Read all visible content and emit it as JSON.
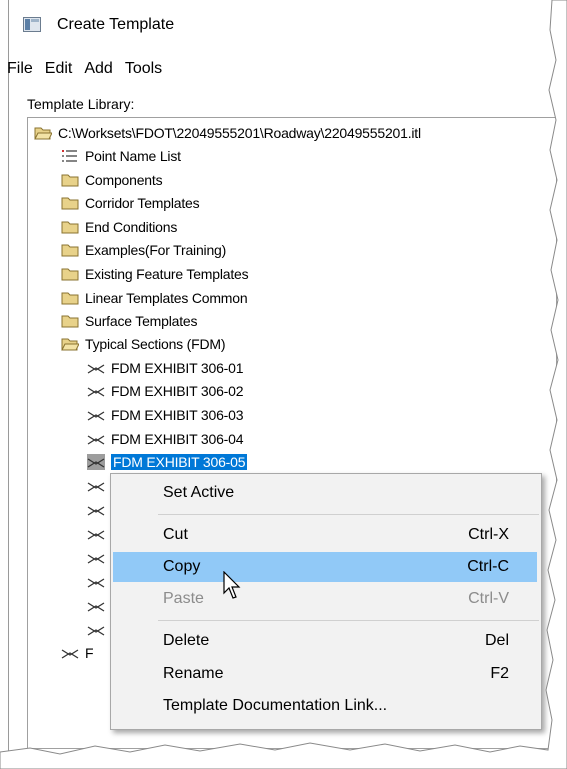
{
  "window": {
    "title": "Create Template",
    "icon": "window-app-icon"
  },
  "menu": [
    "File",
    "Edit",
    "Add",
    "Tools"
  ],
  "library_label": "Template Library:",
  "tree": {
    "root": "C:\\Worksets\\FDOT\\22049555201\\Roadway\\22049555201.itl",
    "point_name_list": "Point Name List",
    "folders": [
      "Components",
      "Corridor Templates",
      "End Conditions",
      "Examples(For Training)",
      "Existing Feature Templates",
      "Linear Templates Common",
      "Surface Templates"
    ],
    "open_folder": "Typical Sections (FDM)",
    "templates": [
      "FDM EXHIBIT 306-01",
      "FDM EXHIBIT 306-02",
      "FDM EXHIBIT 306-03",
      "FDM EXHIBIT 306-04",
      "FDM EXHIBIT 306-05"
    ],
    "selected_template": "FDM EXHIBIT 306-05",
    "partial_item_prefix": "F"
  },
  "context_menu": {
    "set_active": "Set Active",
    "cut": {
      "label": "Cut",
      "shortcut": "Ctrl-X"
    },
    "copy": {
      "label": "Copy",
      "shortcut": "Ctrl-C"
    },
    "paste": {
      "label": "Paste",
      "shortcut": "Ctrl-V"
    },
    "delete": {
      "label": "Delete",
      "shortcut": "Del"
    },
    "rename": {
      "label": "Rename",
      "shortcut": "F2"
    },
    "doc_link": "Template Documentation Link..."
  },
  "colors": {
    "selection": "#0078d7",
    "menu_highlight": "#91c9f7",
    "folder": "#e8d28a"
  }
}
